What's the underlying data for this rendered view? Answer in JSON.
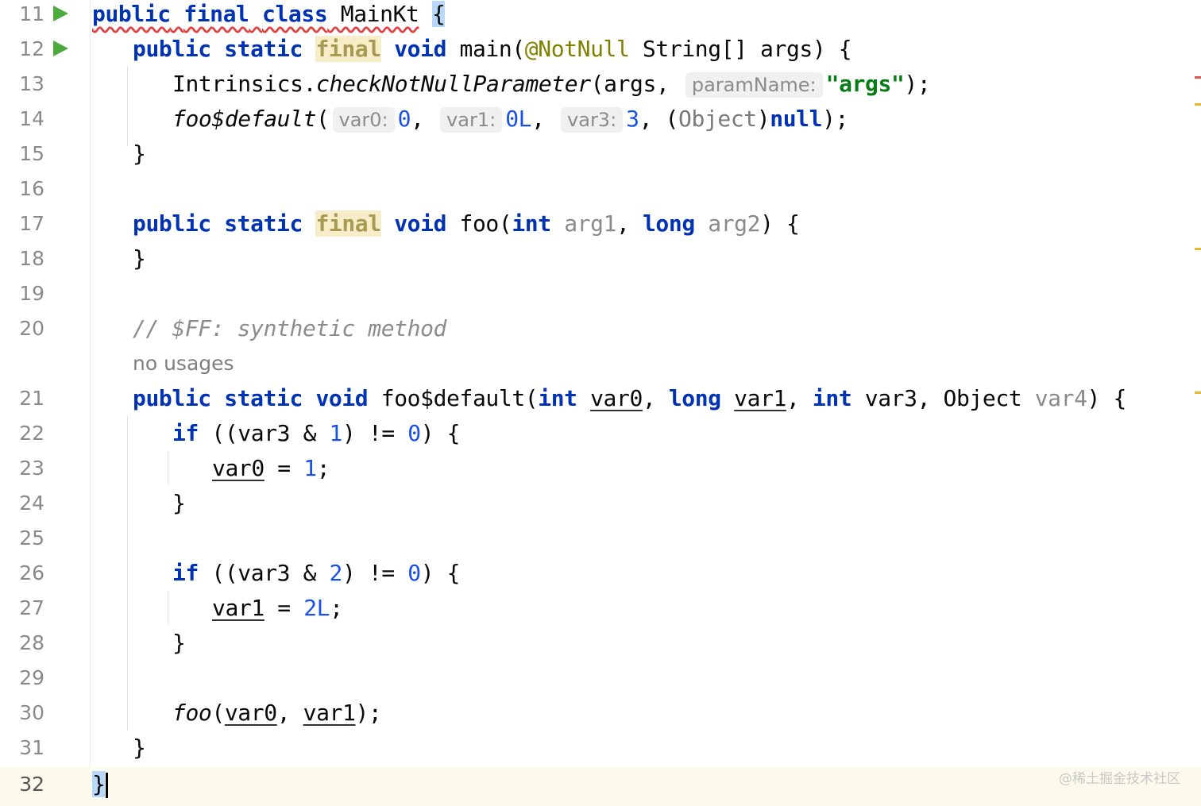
{
  "lines": [
    {
      "n": "11",
      "code": "public final class MainKt {"
    },
    {
      "n": "12",
      "code": "public static final void main(@NotNull String[] args) {"
    },
    {
      "n": "13",
      "code": "Intrinsics.checkNotNullParameter(args, paramName: \"args\");"
    },
    {
      "n": "14",
      "code": "foo$default( var0: 0, var1: 0L, var3: 3, (Object)null);"
    },
    {
      "n": "15",
      "code": "}"
    },
    {
      "n": "16",
      "code": ""
    },
    {
      "n": "17",
      "code": "public static final void foo(int arg1, long arg2) {"
    },
    {
      "n": "18",
      "code": "}"
    },
    {
      "n": "19",
      "code": ""
    },
    {
      "n": "20",
      "code": "// $FF: synthetic method"
    },
    {
      "n": "21",
      "code": "public static void foo$default(int var0, long var1, int var3, Object var4) {"
    },
    {
      "n": "22",
      "code": "if ((var3 & 1) != 0) {"
    },
    {
      "n": "23",
      "code": "var0 = 1;"
    },
    {
      "n": "24",
      "code": "}"
    },
    {
      "n": "25",
      "code": ""
    },
    {
      "n": "26",
      "code": "if ((var3 & 2) != 0) {"
    },
    {
      "n": "27",
      "code": "var1 = 2L;"
    },
    {
      "n": "28",
      "code": "}"
    },
    {
      "n": "29",
      "code": ""
    },
    {
      "n": "30",
      "code": "foo(var0, var1);"
    },
    {
      "n": "31",
      "code": "}"
    },
    {
      "n": "32",
      "code": "}"
    }
  ],
  "usages_hint": "no usages",
  "inlay_hints": {
    "param_name": "paramName:",
    "var0": "var0:",
    "var1": "var1:",
    "var3": "var3:"
  },
  "watermark": "@稀土掘金技术社区",
  "colors": {
    "keyword": "#0033b3",
    "annotation": "#808000",
    "string": "#067d17",
    "number": "#1750eb",
    "comment": "#8c8c8c",
    "run_icon": "#4daa3d",
    "current_line": "#fcfaed"
  }
}
